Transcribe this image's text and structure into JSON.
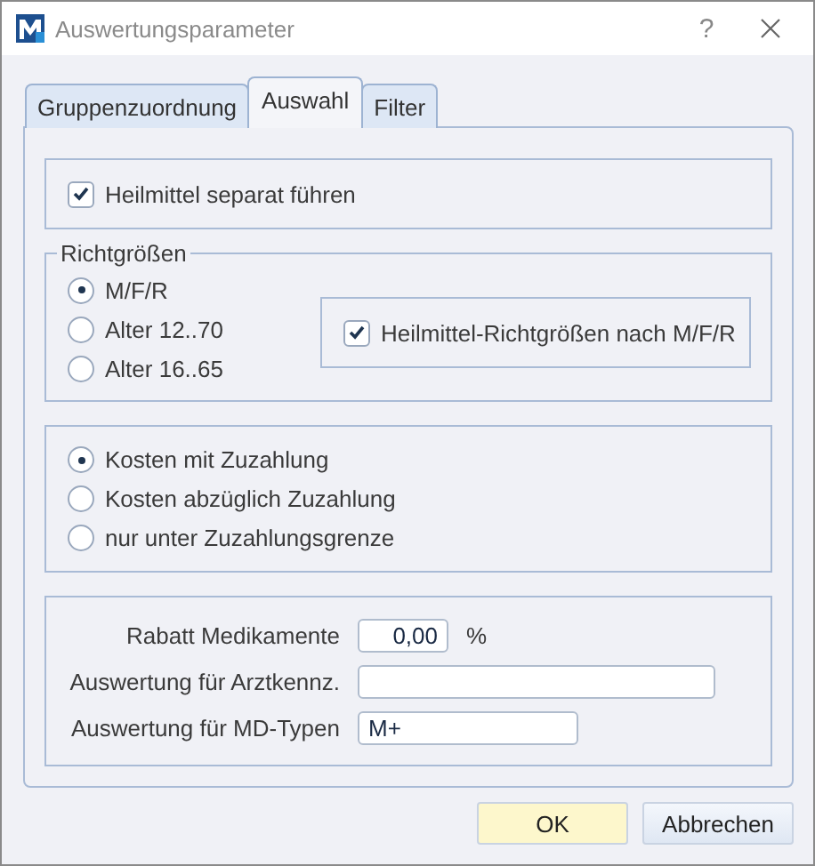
{
  "window": {
    "title": "Auswertungsparameter",
    "help": "?"
  },
  "tabs": [
    {
      "label": "Gruppenzuordnung",
      "selected": false
    },
    {
      "label": "Auswahl",
      "selected": true
    },
    {
      "label": "Filter",
      "selected": false
    }
  ],
  "separate": {
    "label": "Heilmittel separat führen",
    "checked": true
  },
  "richtgroessen": {
    "title": "Richtgrößen",
    "options": [
      {
        "label": "M/F/R",
        "selected": true
      },
      {
        "label": "Alter 12..70",
        "selected": false
      },
      {
        "label": "Alter 16..65",
        "selected": false
      }
    ],
    "check": {
      "label": "Heilmittel-Richtgrößen nach M/F/R",
      "checked": true
    }
  },
  "kosten": [
    {
      "label": "Kosten mit Zuzahlung",
      "selected": true
    },
    {
      "label": "Kosten abzüglich Zuzahlung",
      "selected": false
    },
    {
      "label": "nur unter Zuzahlungsgrenze",
      "selected": false
    }
  ],
  "fields": [
    {
      "label": "Rabatt Medikamente",
      "value": "0,00",
      "unit": "%",
      "kind": "number"
    },
    {
      "label": "Auswertung für Arztkennz.",
      "kind": "wide"
    },
    {
      "label": "Auswertung für MD-Typen",
      "value": "M+",
      "kind": "medium"
    }
  ],
  "buttons": [
    {
      "label": "OK",
      "kind": "default"
    },
    {
      "label": "Abbrechen",
      "kind": "normal"
    }
  ]
}
